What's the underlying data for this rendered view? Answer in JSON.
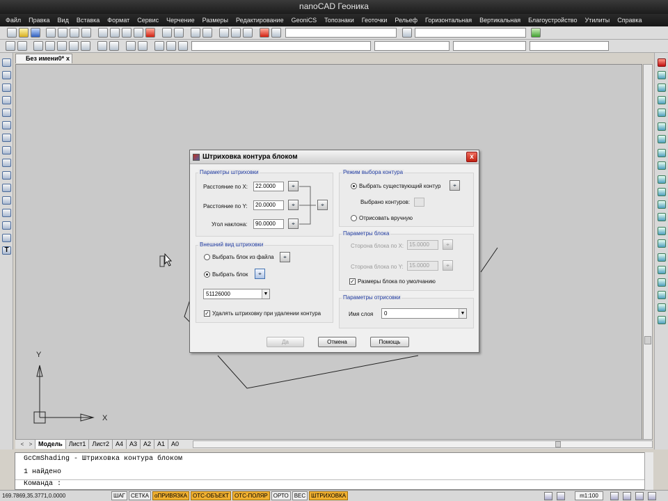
{
  "app": {
    "title": "nanoCAD Геоника"
  },
  "menu": [
    "Файл",
    "Правка",
    "Вид",
    "Вставка",
    "Формат",
    "Сервис",
    "Черчение",
    "Размеры",
    "Редактирование",
    "GeoniCS",
    "Топознаки",
    "Геоточки",
    "Рельеф",
    "Горизонтальная",
    "Вертикальная",
    "Благоустройство",
    "Утилиты",
    "Справка"
  ],
  "doc_tab": {
    "label": "Без имени0*",
    "close": "x"
  },
  "axes": {
    "x": "X",
    "y": "Y"
  },
  "layout_tabs": {
    "arrows": [
      "<",
      ">"
    ],
    "tabs": [
      {
        "label": "Модель",
        "active": true
      },
      {
        "label": "Лист1",
        "active": false
      },
      {
        "label": "Лист2",
        "active": false
      },
      {
        "label": "A4",
        "active": false
      },
      {
        "label": "A3",
        "active": false
      },
      {
        "label": "A2",
        "active": false
      },
      {
        "label": "A1",
        "active": false
      },
      {
        "label": "A0",
        "active": false
      }
    ]
  },
  "command": {
    "lines": [
      "GcCmShading - Штриховка контура блоком",
      "1 найдено",
      "Команда :"
    ]
  },
  "status": {
    "coords": "169.7869,35.3771,0.0000",
    "buttons": [
      {
        "label": "ШАГ",
        "on": false
      },
      {
        "label": "СЕТКА",
        "on": false
      },
      {
        "label": "оПРИВЯЗКА",
        "on": true
      },
      {
        "label": "ОТС-ОБЪЕКТ",
        "on": true
      },
      {
        "label": "ОТС-ПОЛЯР",
        "on": true
      },
      {
        "label": "ОРТО",
        "on": false
      },
      {
        "label": "ВЕС",
        "on": false
      },
      {
        "label": "ШТРИХОВКА",
        "on": true
      }
    ],
    "scale": "m1:100"
  },
  "dialog": {
    "title": "Штриховка контура блоком",
    "close": "x",
    "hatch_params": {
      "label": "Параметры штриховки",
      "dx_label": "Расстояние по X:",
      "dx": "22.0000",
      "dy_label": "Расстояние по Y:",
      "dy": "20.0000",
      "angle_label": "Угол наклона:",
      "angle": "90.0000"
    },
    "appearance": {
      "label": "Внешний вид штриховки",
      "from_file": "Выбрать блок из файла",
      "choose_block": "Выбрать блок",
      "selected_mode": "choose_block",
      "block_name": "51126000",
      "delete_label": "Удалять штриховку при удалении контура",
      "delete_checked": true
    },
    "contour_mode": {
      "label": "Режим выбора контура",
      "existing": "Выбрать существующий контур",
      "selected_label": "Выбрано контуров:",
      "draw": "Отрисовать вручную",
      "selected_mode": "existing"
    },
    "block_params": {
      "label": "Параметры блока",
      "sx_label": "Сторона блока по X:",
      "sx": "15.0000",
      "sy_label": "Сторона блока по Y:",
      "sy": "15.0000",
      "default_label": "Размеры блока по умолчанию",
      "default_checked": true
    },
    "draw_params": {
      "label": "Параметры отрисовки",
      "layer_label": "Имя слоя",
      "layer": "0"
    },
    "buttons": {
      "ok": "Да",
      "cancel": "Отмена",
      "help": "Помощь"
    },
    "pick_glyph": "⌖"
  },
  "colors": {
    "canvas": "#c9c9c9",
    "accent": "#1f3aa0",
    "status_on": "#f0b030"
  }
}
